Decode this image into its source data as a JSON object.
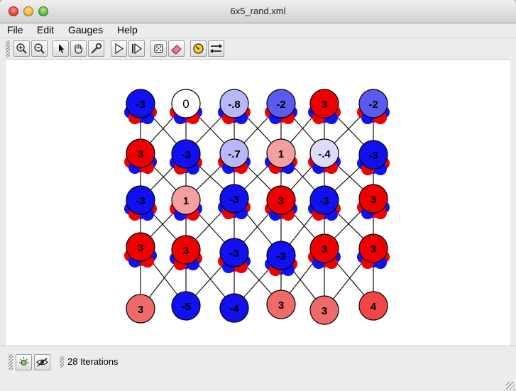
{
  "window": {
    "title": "6x5_rand.xml"
  },
  "menu": [
    "File",
    "Edit",
    "Gauges",
    "Help"
  ],
  "toolbar": {
    "icons": [
      "zoom-in-icon",
      "zoom-out-icon",
      "pointer-icon",
      "hand-pan-icon",
      "wrench-icon",
      "play-icon",
      "step-forward-icon",
      "dice-icon",
      "eraser-icon",
      "gauge-icon",
      "swap-arrows-icon"
    ]
  },
  "status": {
    "icons": [
      "brightness-icon",
      "hide-eye-icon"
    ],
    "iterations": "28 Iterations"
  },
  "graph": {
    "rows": [
      [
        "-3",
        "0",
        "-.8",
        "-2",
        "3",
        "-2"
      ],
      [
        "3",
        "-3",
        "-.7",
        "1",
        "-.4",
        "-3"
      ],
      [
        "-3",
        "1",
        "-3",
        "3",
        "-3",
        "3"
      ],
      [
        "3",
        "3",
        "-3",
        "-3",
        "3",
        "3"
      ],
      [
        "3",
        "-5",
        "-4",
        "3",
        "3",
        "4"
      ]
    ],
    "colors": {
      "strong_blue": "#1010f0",
      "strong_red": "#ee0000",
      "light_blue": "#b8b8f8",
      "light_red": "#f5a0a0",
      "mid_blue": "#5a5aee",
      "salmon": "#f06a6a",
      "white": "#ffffff"
    }
  }
}
